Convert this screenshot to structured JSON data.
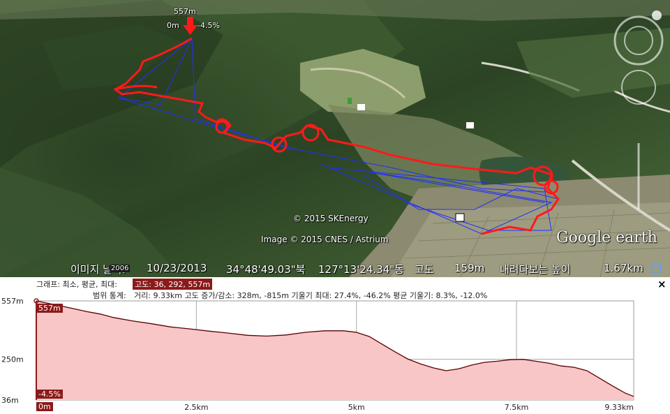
{
  "map": {
    "marker": {
      "elevation": "557m",
      "distance": "0m",
      "grade": "-4.5%"
    },
    "copyright_1": "© 2015 SKEnergy",
    "copyright_2": "Image © 2015 CNES / Astrium",
    "brand": "Google earth"
  },
  "status_bar": {
    "image_date_label": "이미지 날짜:",
    "image_date": "10/23/2013",
    "lat": "34°48'49.03\"북",
    "lon": "127°13'24.34\"동",
    "elevation_label": "고도",
    "elevation": "159m",
    "eye_alt_label": "내려다보는 높이",
    "eye_alt": "1.67km",
    "year_badge": "2006"
  },
  "profile": {
    "close_glyph": "×",
    "row1_label": "그래프: 최소, 평균, 최대:",
    "row1_value": "고도: 36, 292, 557m",
    "row2_label": "범위 통계:",
    "row2_value": "거리: 9.33km 고도 증가/감소: 328m, -815m 기울기 최대: 27.4%, -46.2% 평균 기울기: 8.3%, -12.0%",
    "current_elev": "557m",
    "current_grade": "-4.5%",
    "current_dist": "0m"
  },
  "chart_data": {
    "type": "area",
    "x_unit": "km",
    "y_unit": "m",
    "ylim": [
      36,
      557
    ],
    "xlim": [
      0,
      9.33
    ],
    "y_ticks": [
      "557m",
      "250m",
      "36m"
    ],
    "x_ticks": [
      "2.5km",
      "5km",
      "7.5km",
      "9.33km"
    ],
    "fill_color": "#f8c6c6",
    "line_color": "#5a0000",
    "x": [
      0,
      0.25,
      0.5,
      0.8,
      1.0,
      1.2,
      1.5,
      1.8,
      2.1,
      2.4,
      2.7,
      3.0,
      3.3,
      3.6,
      3.9,
      4.2,
      4.5,
      4.8,
      5.0,
      5.2,
      5.4,
      5.6,
      5.8,
      6.0,
      6.2,
      6.4,
      6.6,
      6.8,
      7.0,
      7.2,
      7.4,
      7.6,
      7.8,
      8.0,
      8.2,
      8.4,
      8.6,
      8.8,
      9.0,
      9.2,
      9.33
    ],
    "y": [
      557,
      540,
      522,
      500,
      488,
      470,
      452,
      437,
      420,
      410,
      398,
      388,
      376,
      372,
      378,
      392,
      400,
      400,
      392,
      370,
      330,
      290,
      252,
      226,
      205,
      190,
      200,
      220,
      234,
      240,
      248,
      250,
      240,
      230,
      215,
      208,
      190,
      150,
      110,
      72,
      55
    ]
  }
}
